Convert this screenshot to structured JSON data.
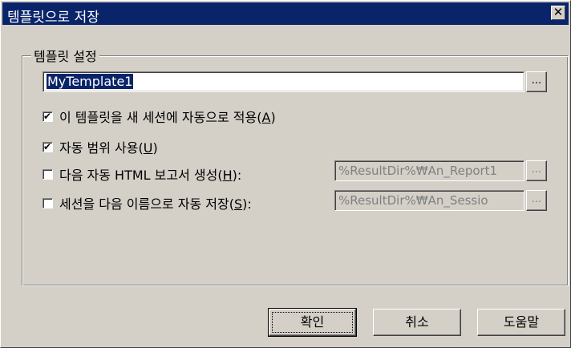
{
  "window": {
    "title": "템플릿으로 저장",
    "close_glyph": "✕"
  },
  "group": {
    "legend": "템플릿 설정"
  },
  "template_name": {
    "value": "MyTemplate1",
    "browse_label": "..."
  },
  "options": [
    {
      "label": "이 템플릿을 새 세션에 자동으로 적용(",
      "mnemonic": "A",
      "suffix": ")",
      "checked": true
    },
    {
      "label": "자동 범위 사용(",
      "mnemonic": "U",
      "suffix": ")",
      "checked": true
    },
    {
      "label": "다음 자동 HTML 보고서 생성(",
      "mnemonic": "H",
      "suffix": "):",
      "checked": false
    },
    {
      "label": "세션을 다음 이름으로 자동 저장(",
      "mnemonic": "S",
      "suffix": "):",
      "checked": false
    }
  ],
  "report_path": {
    "value": "%ResultDir%₩An_Report1",
    "browse_label": "...",
    "enabled": false
  },
  "session_path": {
    "value": "%ResultDir%₩An_Sessio",
    "browse_label": "...",
    "enabled": false
  },
  "check_glyph": "✔",
  "buttons": {
    "ok": "확인",
    "cancel": "취소",
    "help": "도움말"
  }
}
